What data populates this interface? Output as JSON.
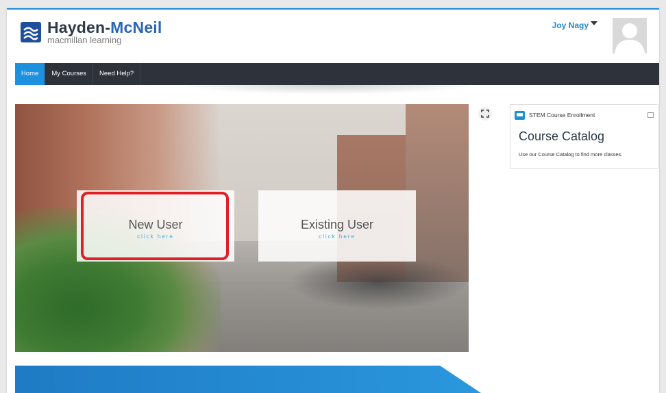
{
  "header": {
    "brand_main": "Hayden-",
    "brand_accent": "McNeil",
    "tagline": "macmillan learning",
    "user_name": "Joy Nagy"
  },
  "nav": {
    "items": [
      {
        "label": "Home",
        "active": true
      },
      {
        "label": "My Courses",
        "active": false
      },
      {
        "label": "Need Help?",
        "active": false
      }
    ]
  },
  "hero": {
    "new_user": {
      "title": "New User",
      "subtitle": "click here"
    },
    "existing_user": {
      "title": "Existing User",
      "subtitle": "click here"
    }
  },
  "widget": {
    "label": "STEM Course Enrollment",
    "title": "Course Catalog",
    "description": "Use our Course Catalog to find more classes."
  },
  "colors": {
    "accent": "#1e90e0",
    "nav_bg": "#2d323b",
    "highlight": "#e01e24"
  },
  "icons": [
    "logo-icon",
    "caret-down-icon",
    "avatar-icon",
    "expand-icon",
    "monitor-icon",
    "minimize-icon"
  ]
}
